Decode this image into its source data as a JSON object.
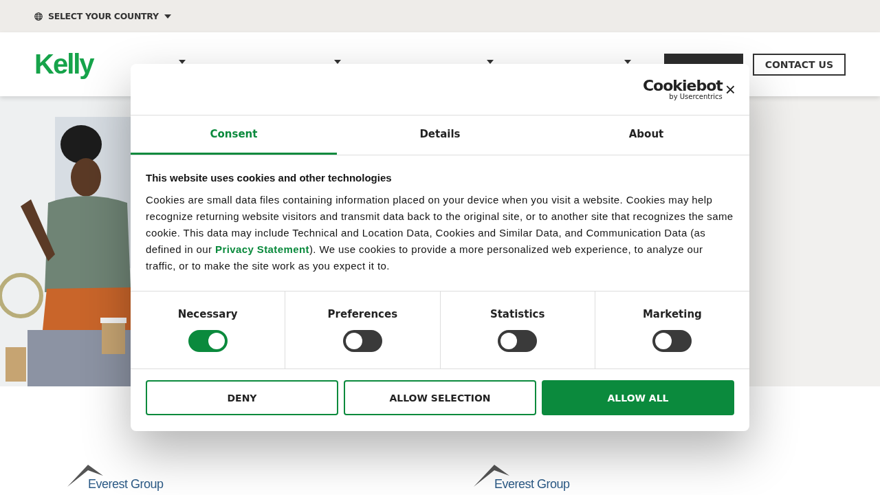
{
  "top_bar": {
    "country_selector": "SELECT YOUR COUNTRY"
  },
  "header": {
    "logo": "Kelly",
    "nav": [
      {
        "dropdown": true
      },
      {
        "dropdown": true
      },
      {
        "dropdown": true
      },
      {
        "dropdown": true
      }
    ],
    "contact": "CONTACT US"
  },
  "partners": [
    {
      "name": "Everest Group"
    },
    {
      "name": "Everest Group"
    }
  ],
  "cookie_dialog": {
    "brand": "Cookiebot",
    "brand_sub": "by Usercentrics",
    "close": "×",
    "tabs": [
      {
        "label": "Consent",
        "selected": true
      },
      {
        "label": "Details",
        "selected": false
      },
      {
        "label": "About",
        "selected": false
      }
    ],
    "title": "This website uses cookies and other technologies",
    "body": "Cookies are small data files containing information placed on your device when you visit a website. Cookies may help recognize returning website visitors and transmit data back to the original site, or to another site that recognizes the same cookie. This data may include Technical and Location Data, Cookies and Similar Data, and Communication Data (as defined in our ",
    "link": "Privacy Statement",
    "body_end": "). We use cookies to provide a more personalized web experience, to analyze our traffic, or to make the site work as you expect it to.",
    "categories": [
      {
        "label": "Necessary",
        "on": true
      },
      {
        "label": "Preferences",
        "on": false
      },
      {
        "label": "Statistics",
        "on": false
      },
      {
        "label": "Marketing",
        "on": false
      }
    ],
    "buttons": [
      {
        "label": "DENY",
        "kind": "outline"
      },
      {
        "label": "ALLOW SELECTION",
        "kind": "outline"
      },
      {
        "label": "ALLOW ALL",
        "kind": "filled"
      }
    ]
  }
}
